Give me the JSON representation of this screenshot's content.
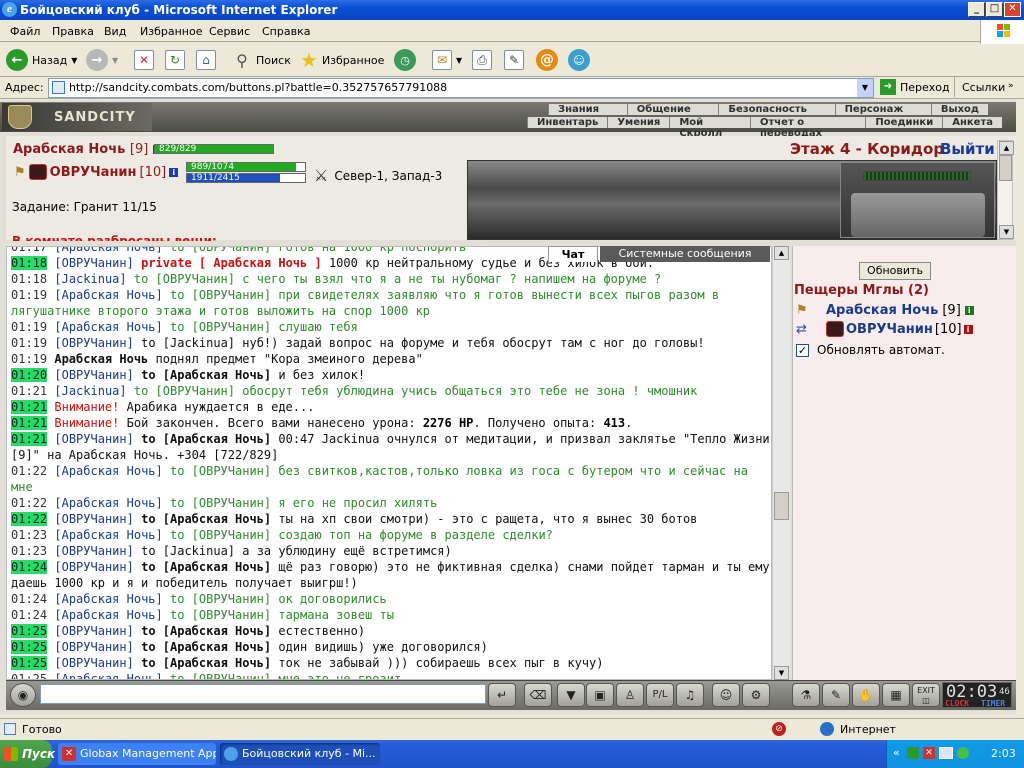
{
  "window": {
    "title": "Бойцовский клуб - Microsoft Internet Explorer",
    "btn_minimize": "_",
    "btn_maximize": "□",
    "btn_close": "✕"
  },
  "menu": [
    "Файл",
    "Правка",
    "Вид",
    "Избранное",
    "Сервис",
    "Справка"
  ],
  "toolbar": {
    "back": "Назад",
    "search": "Поиск",
    "favorites": "Избранное"
  },
  "address": {
    "label": "Адрес:",
    "url": "http://sandcity.combats.com/buttons.pl?battle=0.352757657791088",
    "go": "Переход",
    "links": "Ссылки"
  },
  "game": {
    "logo": "SANDCITY",
    "nav_top": [
      "Знания",
      "Общение",
      "Безопасность",
      "Персонаж",
      "Выход"
    ],
    "nav_bottom": [
      "Инвентарь",
      "Умения",
      "Мой Скролл",
      "Отчет о переводах",
      "Поединки",
      "Анкета"
    ],
    "player_name": "Арабская Ночь",
    "player_level": "[9]",
    "player_hp": "829/829",
    "player_hp_frac": 1.0,
    "opponent_name": "ОВРУЧанин",
    "opponent_level": "[10]",
    "opponent_hp": "989/1074",
    "opponent_hp_frac": 0.92,
    "opponent_mana": "1911/2415",
    "opponent_mana_frac": 0.79,
    "location_coords": "Север-1, Запад-3",
    "task": "Задание: Гранит 11/15",
    "room_items_partial": "В комнате разбросаны вещи:",
    "floor": "Этаж 4 - Коридор",
    "exit": "Выйти"
  },
  "chat_tabs": {
    "chat": "Чат",
    "system": "Системные сообщения"
  },
  "chat": [
    {
      "t": "01:17",
      "hl": false,
      "name": "Арабская Ночь",
      "nb": false,
      "rest": [
        [
          "to",
          "to [ОВРУЧанин] готов на 1000 кр поспорить"
        ]
      ]
    },
    {
      "t": "01:18",
      "hl": true,
      "name": "ОВРУЧанин",
      "nb": false,
      "rest": [
        [
          "prv",
          "private [ Арабская Ночь ]"
        ],
        [
          "blk",
          " 1000 кр нейтральному судье и без хилок в бой."
        ]
      ]
    },
    {
      "t": "01:18",
      "hl": false,
      "name": "Jackinua",
      "nb": false,
      "rest": [
        [
          "to",
          "to [ОВРУЧанин] с чего ты взял что я а не ты нубомаг ? напишем на форуме ?"
        ]
      ]
    },
    {
      "t": "01:19",
      "hl": false,
      "name": "Арабская Ночь",
      "nb": false,
      "rest": [
        [
          "to",
          "to [ОВРУЧанин] при свидетелях заявляю что я готов вынести всех пыгов разом в лягушатнике второго этажа и готов выложить на спор 1000 кр"
        ]
      ]
    },
    {
      "t": "01:19",
      "hl": false,
      "name": "Арабская Ночь",
      "nb": false,
      "rest": [
        [
          "to",
          "to [ОВРУЧанин] слушаю тебя"
        ]
      ]
    },
    {
      "t": "01:19",
      "hl": false,
      "name": "ОВРУЧанин",
      "nb": false,
      "rest": [
        [
          "blk",
          "to [Jackinua] нуб!) задай вопрос на форуме и тебя обосрут там с ног до головы!"
        ]
      ]
    },
    {
      "t": "01:19",
      "hl": false,
      "name": "Арабская Ночь",
      "nb": true,
      "plain": true,
      "rest": [
        [
          "blk",
          " поднял предмет \"Кора змеиного дерева\""
        ]
      ]
    },
    {
      "t": "01:20",
      "hl": true,
      "name": "ОВРУЧанин",
      "nb": false,
      "rest": [
        [
          "bto",
          "to [Арабская Ночь]"
        ],
        [
          "blk",
          " и без хилок!"
        ]
      ]
    },
    {
      "t": "01:21",
      "hl": false,
      "name": "Jackinua",
      "nb": false,
      "rest": [
        [
          "to",
          "to [ОВРУЧанин] обосрут тебя ублюдина учись общаться это тебе не зона ! чмошник"
        ]
      ]
    },
    {
      "t": "01:21",
      "hl": true,
      "noname": true,
      "rest": [
        [
          "att",
          "Внимание!"
        ],
        [
          "blk",
          " Арабика нуждается в еде..."
        ]
      ]
    },
    {
      "t": "01:21",
      "hl": true,
      "noname": true,
      "rest": [
        [
          "att",
          "Внимание!"
        ],
        [
          "blk",
          " Бой закончен. Всего вами нанесено урона: "
        ],
        [
          "dmg",
          "2276 HP"
        ],
        [
          "blk",
          ". Получено опыта: "
        ],
        [
          "dmg",
          "413"
        ],
        [
          "blk",
          "."
        ]
      ]
    },
    {
      "t": "01:21",
      "hl": true,
      "name": "ОВРУЧанин",
      "nb": false,
      "rest": [
        [
          "bto",
          "to [Арабская Ночь]"
        ],
        [
          "blk",
          " 00:47 Jackinua очнулся от медитации, и призвал заклятье \"Тепло Жизни [9]\" на Арабская Ночь. +304 [722/829]"
        ]
      ]
    },
    {
      "t": "01:22",
      "hl": false,
      "name": "Арабская Ночь",
      "nb": false,
      "rest": [
        [
          "to",
          "to [ОВРУЧанин] без свитков,кастов,только ловка из госа с бутером что и сейчас на мне"
        ]
      ]
    },
    {
      "t": "01:22",
      "hl": false,
      "name": "Арабская Ночь",
      "nb": false,
      "rest": [
        [
          "to",
          "to [ОВРУЧанин] я его не просил хилять"
        ]
      ]
    },
    {
      "t": "01:22",
      "hl": true,
      "name": "ОВРУЧанин",
      "nb": false,
      "rest": [
        [
          "bto",
          "to [Арабская Ночь]"
        ],
        [
          "blk",
          " ты на хп свои смотри) - это с ращета, что я вынес 30 ботов"
        ]
      ]
    },
    {
      "t": "01:23",
      "hl": false,
      "name": "Арабская Ночь",
      "nb": false,
      "rest": [
        [
          "to",
          "to [ОВРУЧанин] создаю топ на форуме в разделе сделки?"
        ]
      ]
    },
    {
      "t": "01:23",
      "hl": false,
      "name": "ОВРУЧанин",
      "nb": false,
      "rest": [
        [
          "blk",
          "to [Jackinua] а за ублюдину ещё встретимся)"
        ]
      ]
    },
    {
      "t": "01:24",
      "hl": true,
      "name": "ОВРУЧанин",
      "nb": false,
      "rest": [
        [
          "bto",
          "to [Арабская Ночь]"
        ],
        [
          "blk",
          " щё раз говорю) это не фиктивная сделка) снами пойдет тарман и ты ему даешь 1000 кр и я и победитель получает выигрш!)"
        ]
      ]
    },
    {
      "t": "01:24",
      "hl": false,
      "name": "Арабская Ночь",
      "nb": false,
      "rest": [
        [
          "to",
          "to [ОВРУЧанин] ок договорились"
        ]
      ]
    },
    {
      "t": "01:24",
      "hl": false,
      "name": "Арабская Ночь",
      "nb": false,
      "rest": [
        [
          "to",
          "to [ОВРУЧанин] тармана зовеш ты"
        ]
      ]
    },
    {
      "t": "01:25",
      "hl": true,
      "name": "ОВРУЧанин",
      "nb": false,
      "rest": [
        [
          "bto",
          "to [Арабская Ночь]"
        ],
        [
          "blk",
          " естественно)"
        ]
      ]
    },
    {
      "t": "01:25",
      "hl": true,
      "name": "ОВРУЧанин",
      "nb": false,
      "rest": [
        [
          "bto",
          "to [Арабская Ночь]"
        ],
        [
          "blk",
          " один видишь) уже договорился)"
        ]
      ]
    },
    {
      "t": "01:25",
      "hl": true,
      "name": "ОВРУЧанин",
      "nb": false,
      "rest": [
        [
          "bto",
          "to [Арабская Ночь]"
        ],
        [
          "blk",
          " ток не забывай ))) собираешь всех пыг в кучу)"
        ]
      ]
    },
    {
      "t": "01:25",
      "hl": false,
      "name": "Арабская Ночь",
      "nb": false,
      "rest": [
        [
          "to",
          "to [ОВРУЧанин] мне это не грозит"
        ]
      ]
    }
  ],
  "right_panel": {
    "refresh": "Обновить",
    "location": "Пещеры Мглы (2)",
    "users": [
      {
        "name": "Арабская Ночь",
        "level": "[9]"
      },
      {
        "name": "ОВРУЧанин",
        "level": "[10]"
      }
    ],
    "auto_refresh": "Обновлять автомат.",
    "auto_refresh_checked": true
  },
  "clock": {
    "time": "02:03",
    "sec": "46",
    "label1": "CLOCK",
    "label2": "TIMER",
    "exit": "EXIT"
  },
  "statusbar": {
    "status": "Готово",
    "zone": "Интернет"
  },
  "taskbar": {
    "start": "Пуск",
    "tasks": [
      "Globax Management App...",
      "Бойцовский клуб - Mi..."
    ],
    "time": "2:03"
  }
}
